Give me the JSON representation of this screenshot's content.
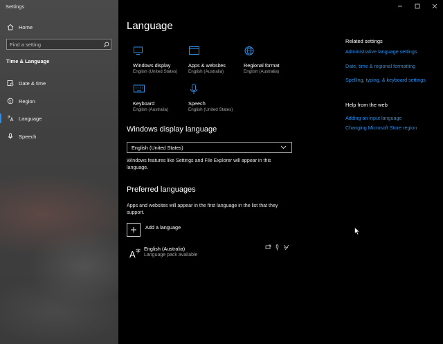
{
  "window": {
    "title": "Settings"
  },
  "colors": {
    "accent": "#2a8fe8",
    "sidebar_bg": "#404040",
    "main_bg": "#000000"
  },
  "sidebar": {
    "home_label": "Home",
    "search_placeholder": "Find a setting",
    "section_title": "Time & Language",
    "items": [
      {
        "label": "Date & time",
        "icon": "calendar-icon"
      },
      {
        "label": "Region",
        "icon": "globe-icon"
      },
      {
        "label": "Language",
        "icon": "language-icon",
        "active": true
      },
      {
        "label": "Speech",
        "icon": "microphone-icon"
      }
    ]
  },
  "main": {
    "title": "Language",
    "tiles": [
      {
        "label": "Windows display",
        "sub": "English (United States)",
        "icon": "monitor-icon"
      },
      {
        "label": "Apps & websites",
        "sub": "English (Australia)",
        "icon": "browser-window-icon"
      },
      {
        "label": "Regional format",
        "sub": "English (Australia)",
        "icon": "globe-icon"
      },
      {
        "label": "Keyboard",
        "sub": "English (Australia)",
        "icon": "keyboard-icon"
      },
      {
        "label": "Speech",
        "sub": "English (United States)",
        "icon": "microphone-icon"
      }
    ],
    "display_language": {
      "heading": "Windows display language",
      "selected": "English (United States)",
      "note": "Windows features like Settings and File Explorer will appear in this language."
    },
    "preferred": {
      "heading": "Preferred languages",
      "note": "Apps and websites will appear in the first language in the list that they support.",
      "add_label": "Add a language",
      "languages": [
        {
          "name": "English (Australia)",
          "status": "Language pack available"
        }
      ]
    }
  },
  "related": {
    "heading": "Related settings",
    "links": [
      "Administrative language settings",
      "Date, time & regional formatting",
      "Spelling, typing, & keyboard settings"
    ]
  },
  "help": {
    "heading": "Help from the web",
    "links": [
      "Adding an input language",
      "Changing Microsoft Store region"
    ]
  }
}
